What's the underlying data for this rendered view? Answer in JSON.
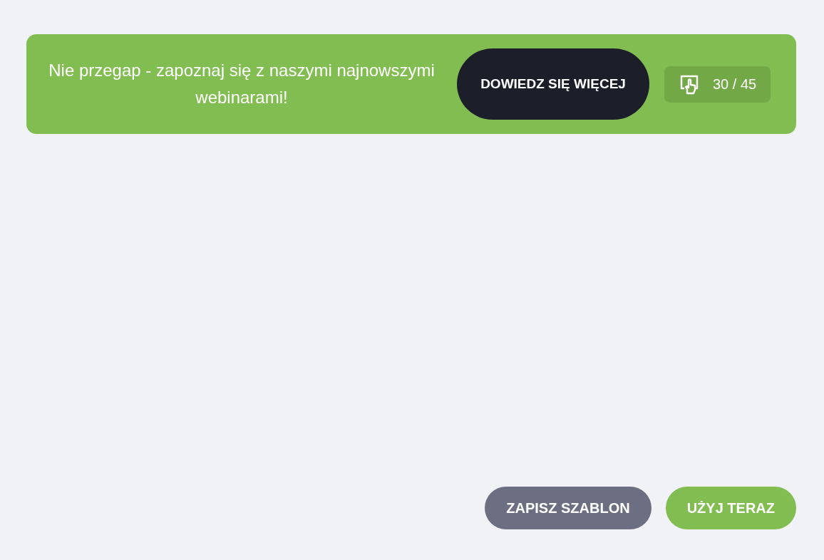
{
  "banner": {
    "message": "Nie przegap - zapoznaj się z naszymi najnowszymi webinarami!",
    "cta": "DOWIEDZ SIĘ WIĘCEJ",
    "counter": "30 / 45"
  },
  "actions": [
    {
      "label": "ZAPISZ SZABLON",
      "kind": "secondary"
    },
    {
      "label": "UŻYJ TERAZ",
      "kind": "primary"
    }
  ]
}
